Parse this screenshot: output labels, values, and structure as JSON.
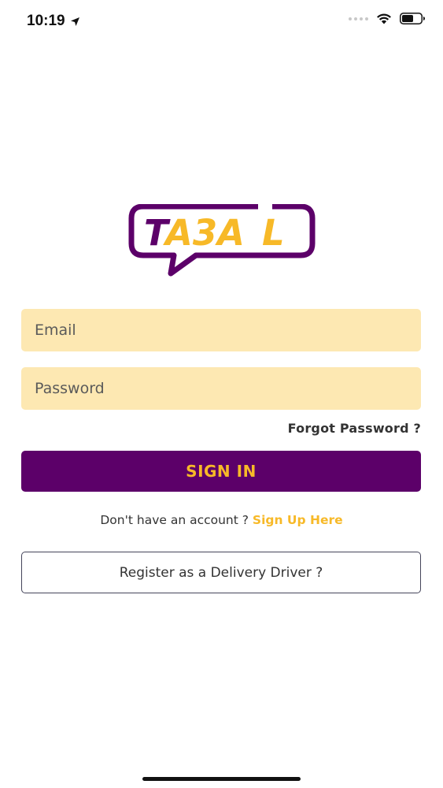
{
  "status_bar": {
    "time": "10:19",
    "location_icon": "location-arrow-icon",
    "wifi_icon": "wifi-icon",
    "battery_icon": "battery-icon"
  },
  "logo": {
    "text": "TA3AL",
    "colors": {
      "outline": "#5c0069",
      "letter_dark": "#5c0069",
      "letter_accent": "#f7b928"
    }
  },
  "login": {
    "email_placeholder": "Email",
    "email_value": "",
    "password_placeholder": "Password",
    "password_value": "",
    "forgot_label": "Forgot Password ?",
    "signin_label": "SIGN IN",
    "signup_prompt": "Don't have an account ? ",
    "signup_link": "Sign Up Here",
    "driver_label": "Register as a Delivery Driver ?"
  },
  "colors": {
    "primary": "#5c0069",
    "accent": "#f7b928",
    "field_bg": "#fde8b2"
  }
}
